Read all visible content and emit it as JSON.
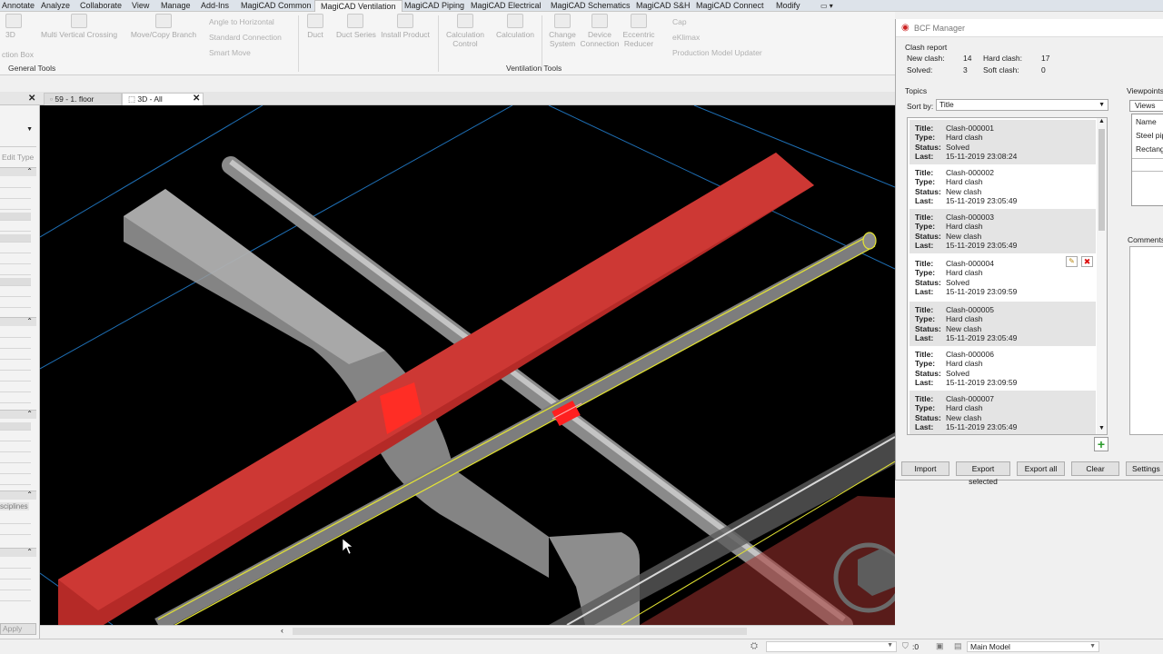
{
  "ribbon_tabs": [
    "Annotate",
    "Analyze",
    "Collaborate",
    "View",
    "Manage",
    "Add-Ins",
    "MagiCAD Common",
    "MagiCAD Ventilation",
    "MagiCAD Piping",
    "MagiCAD Electrical",
    "MagiCAD Schematics",
    "MagiCAD S&H",
    "MagiCAD Connect",
    "Modify"
  ],
  "ribbon": {
    "box_label": "3D",
    "box_label2": "ction Box",
    "multi_vertical": "Multi Vertical Crossing",
    "move_copy": "Move/Copy Branch",
    "angle": "Angle to Horizontal",
    "standard": "Standard Connection",
    "smart_move": "Smart Move",
    "duct": "Duct",
    "duct_series": "Duct Series",
    "install_product": "Install Product",
    "calc_control_1": "Calculation",
    "calc_control_2": "Control",
    "calculation": "Calculation",
    "change_system_1": "Change",
    "change_system_2": "System",
    "device_conn_1": "Device",
    "device_conn_2": "Connection",
    "eccentric_1": "Eccentric",
    "eccentric_2": "Reducer",
    "cap": "Cap",
    "eklimax": "eKlimax",
    "production": "Production",
    "model_updater": "Model Updater",
    "general_tools": "General Tools",
    "ventilation_tools": "Ventilation Tools"
  },
  "doc_tabs": [
    "59 - 1. floor",
    "3D - All"
  ],
  "left_panel": {
    "edit_type": "Edit Type",
    "disciplines": "sciplines",
    "apply": "Apply"
  },
  "bcf": {
    "title": "BCF Manager",
    "clash_report": "Clash report",
    "new_clash_label": "New clash:",
    "new_clash": "14",
    "hard_clash_label": "Hard clash:",
    "hard_clash": "17",
    "solved_label": "Solved:",
    "solved": "3",
    "soft_clash_label": "Soft clash:",
    "soft_clash": "0",
    "topics_label": "Topics",
    "viewpoints_label": "Viewpoints",
    "sort_by_label": "Sort by:",
    "sort_by": "Title",
    "views_tab": "Views",
    "vp_rows": [
      "Name",
      "Steel pip",
      "Rectang"
    ],
    "comments_label": "Comments",
    "field_labels": {
      "title": "Title:",
      "type": "Type:",
      "status": "Status:",
      "last": "Last:"
    },
    "topics": [
      {
        "title": "Clash-000001",
        "type": "Hard clash",
        "status": "Solved",
        "last": "15-11-2019 23:08:24"
      },
      {
        "title": "Clash-000002",
        "type": "Hard clash",
        "status": "New clash",
        "last": "15-11-2019 23:05:49"
      },
      {
        "title": "Clash-000003",
        "type": "Hard clash",
        "status": "New clash",
        "last": "15-11-2019 23:05:49"
      },
      {
        "title": "Clash-000004",
        "type": "Hard clash",
        "status": "Solved",
        "last": "15-11-2019 23:09:59"
      },
      {
        "title": "Clash-000005",
        "type": "Hard clash",
        "status": "New clash",
        "last": "15-11-2019 23:05:49"
      },
      {
        "title": "Clash-000006",
        "type": "Hard clash",
        "status": "Solved",
        "last": "15-11-2019 23:09:59"
      },
      {
        "title": "Clash-000007",
        "type": "Hard clash",
        "status": "New clash",
        "last": "15-11-2019 23:05:49"
      }
    ],
    "buttons": {
      "import": "Import",
      "export_selected": "Export selected",
      "export_all": "Export all",
      "clear": "Clear",
      "settings": "Settings"
    }
  },
  "status": {
    "zero": ":0",
    "model": "Main Model"
  },
  "colors": {
    "duct_red": "#c0302c",
    "pipe_grey": "#9a9a9a",
    "grid_blue": "#1e6fb5",
    "highlight_yellow": "#e6e632"
  }
}
